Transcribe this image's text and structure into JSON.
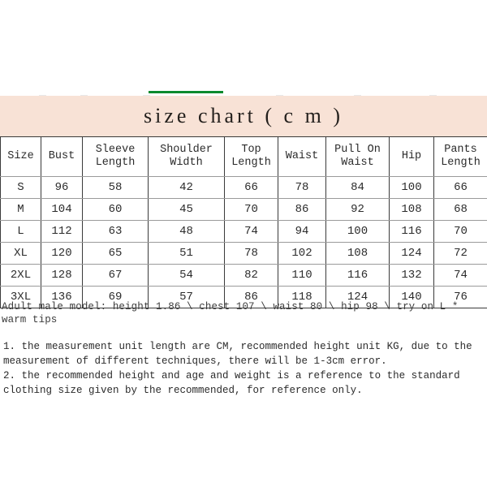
{
  "theme": {
    "title_band_color": "#F8E2D6",
    "accent_rule_color": "#0A8A2E",
    "page_background": "#FFFFFF",
    "table_border_color": "#3A3A3A",
    "text_color": "#2B2B2B"
  },
  "title": "size chart ( c m )",
  "table": {
    "headers": [
      "Size",
      "Bust",
      "Sleeve\nLength",
      "Shoulder\nWidth",
      "Top\nLength",
      "Waist",
      "Pull On\nWaist",
      "Hip",
      "Pants\nLength"
    ],
    "rows": [
      [
        "S",
        "96",
        "58",
        "42",
        "66",
        "78",
        "84",
        "100",
        "66"
      ],
      [
        "M",
        "104",
        "60",
        "45",
        "70",
        "86",
        "92",
        "108",
        "68"
      ],
      [
        "L",
        "112",
        "63",
        "48",
        "74",
        "94",
        "100",
        "116",
        "70"
      ],
      [
        "XL",
        "120",
        "65",
        "51",
        "78",
        "102",
        "108",
        "124",
        "72"
      ],
      [
        "2XL",
        "128",
        "67",
        "54",
        "82",
        "110",
        "116",
        "132",
        "74"
      ],
      [
        "3XL",
        "136",
        "69",
        "57",
        "86",
        "118",
        "124",
        "140",
        "76"
      ]
    ]
  },
  "model_note": "Adult male model: height 1.86 \\ chest 107 \\ waist 80 \\ hip 98 \\ try on L * warm tips",
  "notes": [
    "1. the measurement unit length are CM, recommended height unit KG, due to the measurement of different techniques, there will be 1-3cm error.",
    "2. the recommended height and age and weight is a reference to the standard clothing size given by the recommended, for reference only."
  ]
}
